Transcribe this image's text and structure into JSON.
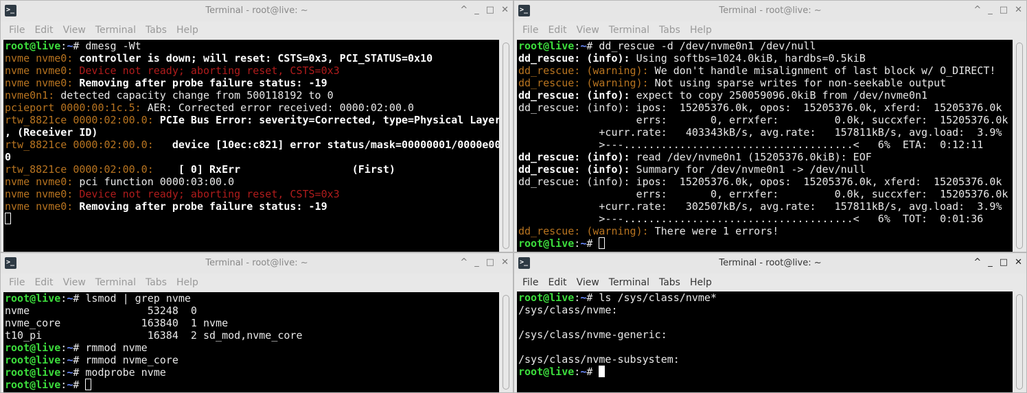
{
  "windows": [
    {
      "title": "Terminal - root@live: ~",
      "active": false,
      "menu": [
        "File",
        "Edit",
        "View",
        "Terminal",
        "Tabs",
        "Help"
      ],
      "cursor": "hollow",
      "lines": [
        [
          {
            "t": "root@live",
            "c": "g"
          },
          {
            "t": ":",
            "c": "w"
          },
          {
            "t": "~",
            "c": "b"
          },
          {
            "t": "# dmesg -Wt",
            "c": "w"
          }
        ],
        [
          {
            "t": "nvme nvme0: ",
            "c": "o"
          },
          {
            "t": "controller is down; will reset: CSTS=0x3, PCI_STATUS=0x10",
            "c": "wb"
          }
        ],
        [
          {
            "t": "nvme nvme0: ",
            "c": "o"
          },
          {
            "t": "Device not ready; aborting reset, CSTS=0x3",
            "c": "r"
          }
        ],
        [
          {
            "t": "nvme nvme0: ",
            "c": "o"
          },
          {
            "t": "Removing after probe failure status: -19",
            "c": "wb"
          }
        ],
        [
          {
            "t": "nvme0n1: ",
            "c": "o"
          },
          {
            "t": "detected capacity change from 500118192 to 0",
            "c": "w"
          }
        ],
        [
          {
            "t": "pcieport 0000:00:1c.5: ",
            "c": "o"
          },
          {
            "t": "AER: Corrected error received: 0000:02:00.0",
            "c": "w"
          }
        ],
        [
          {
            "t": "rtw_8821ce 0000:02:00.0: ",
            "c": "o"
          },
          {
            "t": "PCIe Bus Error: severity=Corrected, type=Physical Layer",
            "c": "wb"
          }
        ],
        [
          {
            "t": ", (Receiver ID)",
            "c": "wb"
          }
        ],
        [
          {
            "t": "rtw_8821ce 0000:02:00.0: ",
            "c": "o"
          },
          {
            "t": "  device [10ec:c821] error status/mask=00000001/0000e00",
            "c": "wb"
          }
        ],
        [
          {
            "t": "0",
            "c": "wb"
          }
        ],
        [
          {
            "t": "rtw_8821ce 0000:02:00.0: ",
            "c": "o"
          },
          {
            "t": "   [ 0] RxErr                  (First)",
            "c": "wb"
          }
        ],
        [
          {
            "t": "nvme nvme0: ",
            "c": "o"
          },
          {
            "t": "pci function 0000:03:00.0",
            "c": "w"
          }
        ],
        [
          {
            "t": "nvme nvme0: ",
            "c": "o"
          },
          {
            "t": "Device not ready; aborting reset, CSTS=0x3",
            "c": "r"
          }
        ],
        [
          {
            "t": "nvme nvme0: ",
            "c": "o"
          },
          {
            "t": "Removing after probe failure status: -19",
            "c": "wb"
          }
        ],
        [
          {
            "t": "",
            "c": "cursor"
          }
        ]
      ]
    },
    {
      "title": "Terminal - root@live: ~",
      "active": false,
      "menu": [
        "File",
        "Edit",
        "View",
        "Terminal",
        "Tabs",
        "Help"
      ],
      "cursor": "hollow",
      "lines": [
        [
          {
            "t": "root@live",
            "c": "g"
          },
          {
            "t": ":",
            "c": "w"
          },
          {
            "t": "~",
            "c": "b"
          },
          {
            "t": "# dd_rescue -d /dev/nvme0n1 /dev/null",
            "c": "w"
          }
        ],
        [
          {
            "t": "dd_rescue: (info):",
            "c": "wb"
          },
          {
            "t": " Using softbs=1024.0kiB, hardbs=0.5kiB",
            "c": "w"
          }
        ],
        [
          {
            "t": "dd_rescue: (warning):",
            "c": "o"
          },
          {
            "t": " We don't handle misalignment of last block w/ O_DIRECT!",
            "c": "w"
          }
        ],
        [
          {
            "t": "dd_rescue: (warning):",
            "c": "o"
          },
          {
            "t": " Not using sparse writes for non-seekable output",
            "c": "w"
          }
        ],
        [
          {
            "t": "dd_rescue: (info):",
            "c": "wb"
          },
          {
            "t": " expect to copy 250059096.0kiB from /dev/nvme0n1",
            "c": "w"
          }
        ],
        [
          {
            "t": "dd_rescue: (info): ipos:  15205376.0k, opos:  15205376.0k, xferd:  15205376.0k",
            "c": "w"
          }
        ],
        [
          {
            "t": "                   errs:       0, errxfer:         0.0k, succxfer:  15205376.0k",
            "c": "w"
          }
        ],
        [
          {
            "t": "             +curr.rate:   403343kB/s, avg.rate:   157811kB/s, avg.load:  3.9%",
            "c": "w"
          }
        ],
        [
          {
            "t": "             >---.....................................<   6%  ETA:  0:12:11",
            "c": "w"
          }
        ],
        [
          {
            "t": "dd_rescue: (info):",
            "c": "wb"
          },
          {
            "t": " read /dev/nvme0n1 (15205376.0kiB): EOF",
            "c": "w"
          }
        ],
        [
          {
            "t": "dd_rescue: (info):",
            "c": "wb"
          },
          {
            "t": " Summary for /dev/nvme0n1 -> /dev/null",
            "c": "w"
          }
        ],
        [
          {
            "t": "dd_rescue: (info): ipos:  15205376.0k, opos:  15205376.0k, xferd:  15205376.0k",
            "c": "w"
          }
        ],
        [
          {
            "t": "                   errs:       0, errxfer:         0.0k, succxfer:  15205376.0k",
            "c": "w"
          }
        ],
        [
          {
            "t": "             +curr.rate:   302507kB/s, avg.rate:   157811kB/s, avg.load:  3.9%",
            "c": "w"
          }
        ],
        [
          {
            "t": "             >---.....................................<   6%  TOT:  0:01:36",
            "c": "w"
          }
        ],
        [
          {
            "t": "dd_rescue: (warning):",
            "c": "o"
          },
          {
            "t": " There were 1 errors!",
            "c": "w"
          }
        ],
        [
          {
            "t": "root@live",
            "c": "g"
          },
          {
            "t": ":",
            "c": "w"
          },
          {
            "t": "~",
            "c": "b"
          },
          {
            "t": "# ",
            "c": "w"
          },
          {
            "t": "",
            "c": "cursor"
          }
        ]
      ]
    },
    {
      "title": "Terminal - root@live: ~",
      "active": false,
      "menu": [
        "File",
        "Edit",
        "View",
        "Terminal",
        "Tabs",
        "Help"
      ],
      "cursor": "hollow",
      "lines": [
        [
          {
            "t": "root@live",
            "c": "g"
          },
          {
            "t": ":",
            "c": "w"
          },
          {
            "t": "~",
            "c": "b"
          },
          {
            "t": "# lsmod | grep nvme",
            "c": "w"
          }
        ],
        [
          {
            "t": "nvme                   53248  0",
            "c": "w"
          }
        ],
        [
          {
            "t": "nvme_core             163840  1 nvme",
            "c": "w"
          }
        ],
        [
          {
            "t": "t10_pi                 16384  2 sd_mod,nvme_core",
            "c": "w"
          }
        ],
        [
          {
            "t": "root@live",
            "c": "g"
          },
          {
            "t": ":",
            "c": "w"
          },
          {
            "t": "~",
            "c": "b"
          },
          {
            "t": "# rmmod nvme",
            "c": "w"
          }
        ],
        [
          {
            "t": "root@live",
            "c": "g"
          },
          {
            "t": ":",
            "c": "w"
          },
          {
            "t": "~",
            "c": "b"
          },
          {
            "t": "# rmmod nvme_core",
            "c": "w"
          }
        ],
        [
          {
            "t": "root@live",
            "c": "g"
          },
          {
            "t": ":",
            "c": "w"
          },
          {
            "t": "~",
            "c": "b"
          },
          {
            "t": "# modprobe nvme",
            "c": "w"
          }
        ],
        [
          {
            "t": "root@live",
            "c": "g"
          },
          {
            "t": ":",
            "c": "w"
          },
          {
            "t": "~",
            "c": "b"
          },
          {
            "t": "# ",
            "c": "w"
          },
          {
            "t": "",
            "c": "cursor"
          }
        ]
      ]
    },
    {
      "title": "Terminal - root@live: ~",
      "active": true,
      "menu": [
        "File",
        "Edit",
        "View",
        "Terminal",
        "Tabs",
        "Help"
      ],
      "cursor": "solid",
      "lines": [
        [
          {
            "t": "root@live",
            "c": "g"
          },
          {
            "t": ":",
            "c": "w"
          },
          {
            "t": "~",
            "c": "b"
          },
          {
            "t": "# ls /sys/class/nvme*",
            "c": "w"
          }
        ],
        [
          {
            "t": "/sys/class/nvme:",
            "c": "w"
          }
        ],
        [
          {
            "t": "",
            "c": "w"
          }
        ],
        [
          {
            "t": "/sys/class/nvme-generic:",
            "c": "w"
          }
        ],
        [
          {
            "t": "",
            "c": "w"
          }
        ],
        [
          {
            "t": "/sys/class/nvme-subsystem:",
            "c": "w"
          }
        ],
        [
          {
            "t": "root@live",
            "c": "g"
          },
          {
            "t": ":",
            "c": "w"
          },
          {
            "t": "~",
            "c": "b"
          },
          {
            "t": "# ",
            "c": "w"
          },
          {
            "t": "",
            "c": "cursor"
          }
        ]
      ]
    }
  ]
}
